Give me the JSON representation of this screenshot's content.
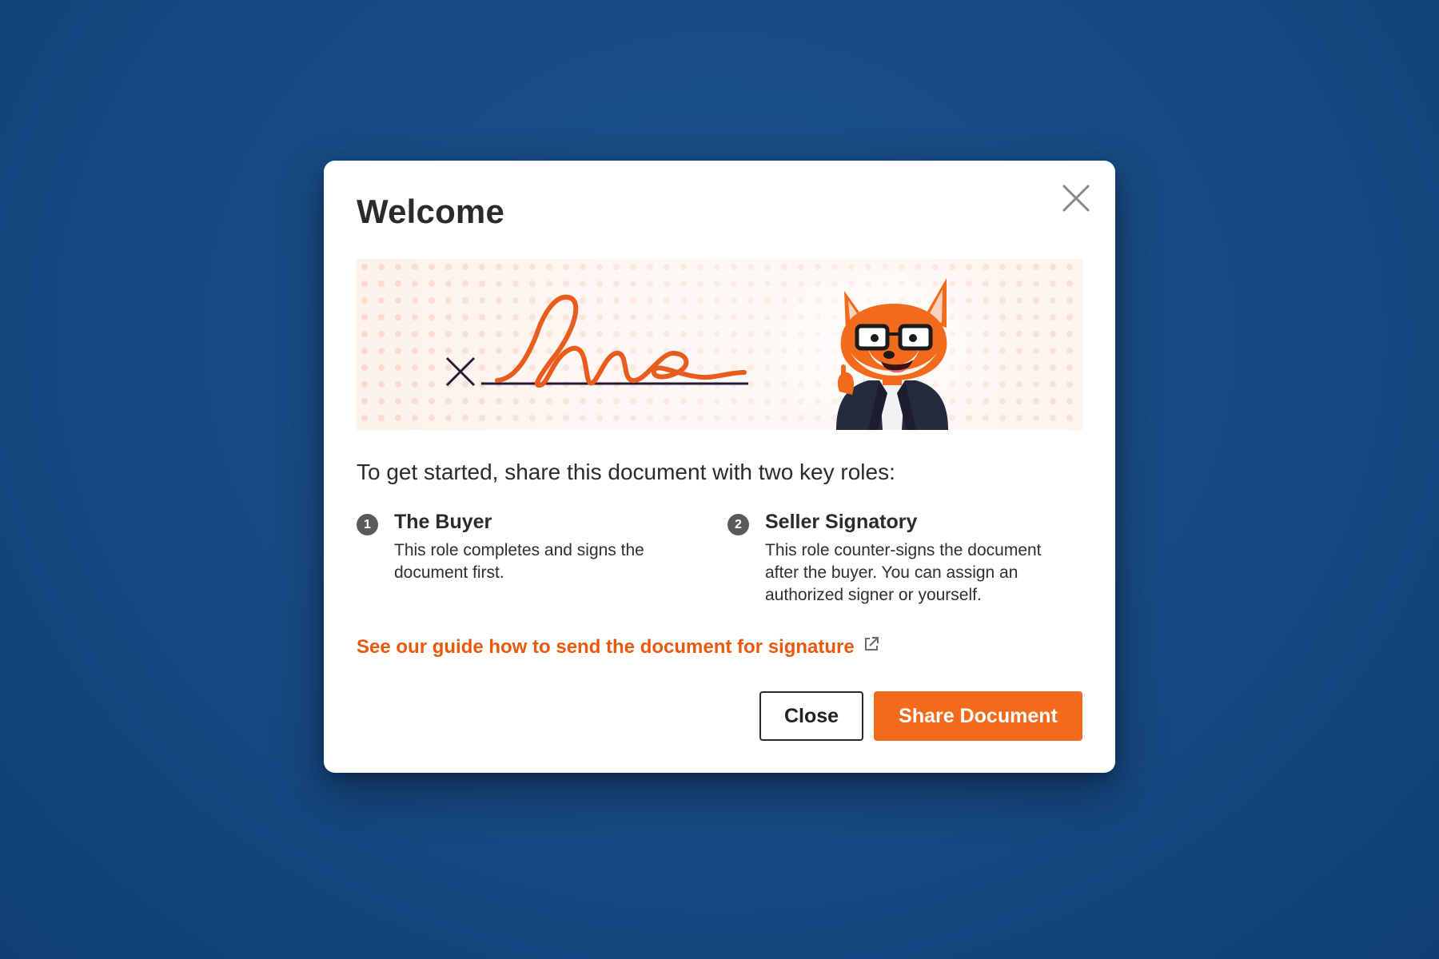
{
  "dialog": {
    "title": "Welcome",
    "intro": "To get started, share this document with two key roles:",
    "roles": [
      {
        "number": "1",
        "name": "The Buyer",
        "description": "This role completes and signs the document first."
      },
      {
        "number": "2",
        "name": "Seller Signatory",
        "description": "This role counter-signs the document after the buyer. You can assign an authorized signer or yourself."
      }
    ],
    "guide_link": "See our guide how to send the document for signature",
    "close_label": "Close",
    "share_label": "Share Document"
  },
  "icons": {
    "close": "close-icon",
    "external_link": "external-link-icon"
  },
  "colors": {
    "background": "#164a82",
    "accent": "#f26a1b",
    "link": "#e8590c",
    "text": "#2b2b2b"
  }
}
